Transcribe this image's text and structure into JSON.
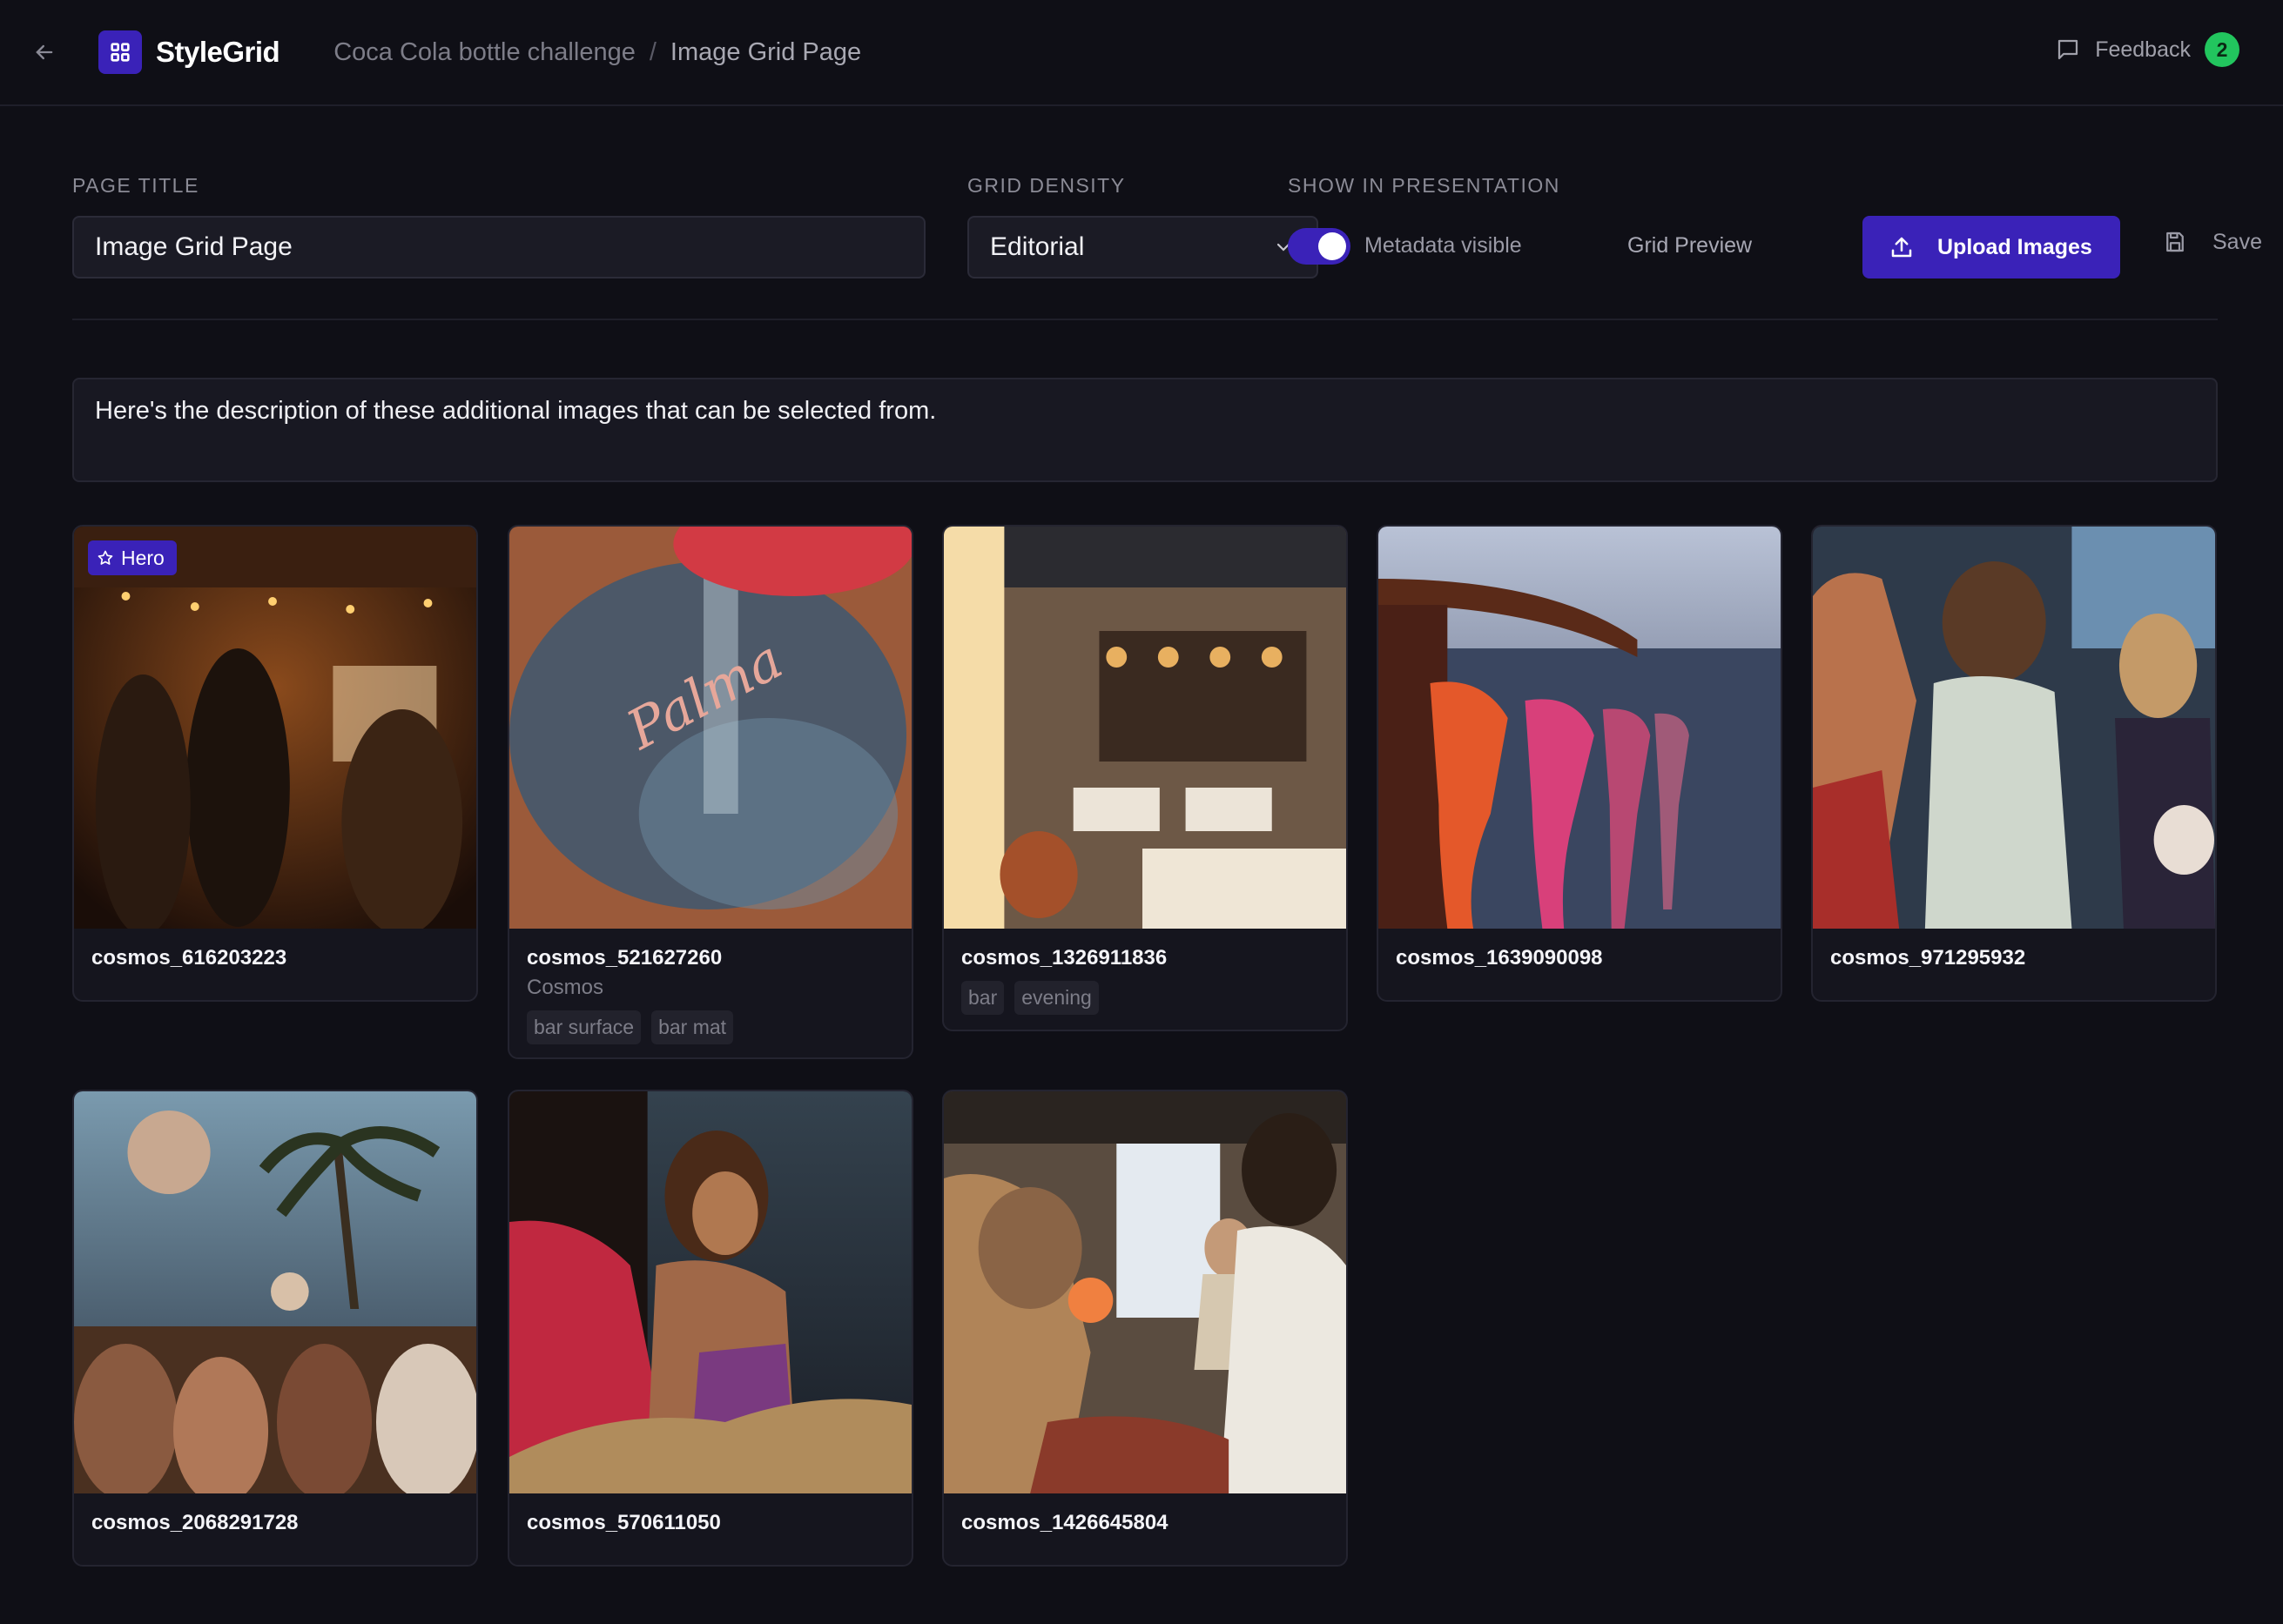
{
  "header": {
    "app_name": "StyleGrid",
    "breadcrumb": [
      "Coca Cola bottle challenge",
      "Image Grid Page"
    ],
    "breadcrumb_separator": "/",
    "feedback_label": "Feedback",
    "feedback_count": "2"
  },
  "controls": {
    "page_title_label": "PAGE TITLE",
    "page_title_value": "Image Grid Page",
    "grid_density_label": "GRID DENSITY",
    "grid_density_value": "Editorial",
    "presentation_label": "SHOW IN PRESENTATION",
    "metadata_toggle_on": true,
    "metadata_label": "Metadata visible",
    "grid_preview_label": "Grid Preview",
    "upload_label": "Upload Images",
    "save_label": "Save"
  },
  "description": "Here's the description of these additional images that can be selected from.",
  "hero_badge_label": "Hero",
  "cards": [
    {
      "name": "cosmos_616203223",
      "hero": true
    },
    {
      "name": "cosmos_521627260",
      "source": "Cosmos",
      "tags": [
        "bar surface",
        "bar mat"
      ]
    },
    {
      "name": "cosmos_1326911836",
      "tags": [
        "bar",
        "evening"
      ]
    },
    {
      "name": "cosmos_1639090098"
    },
    {
      "name": "cosmos_971295932"
    },
    {
      "name": "cosmos_2068291728"
    },
    {
      "name": "cosmos_570611050"
    },
    {
      "name": "cosmos_1426645804"
    }
  ],
  "colors": {
    "accent": "#3a22b8",
    "badge_green": "#22c55e",
    "background": "#0f0f16"
  }
}
